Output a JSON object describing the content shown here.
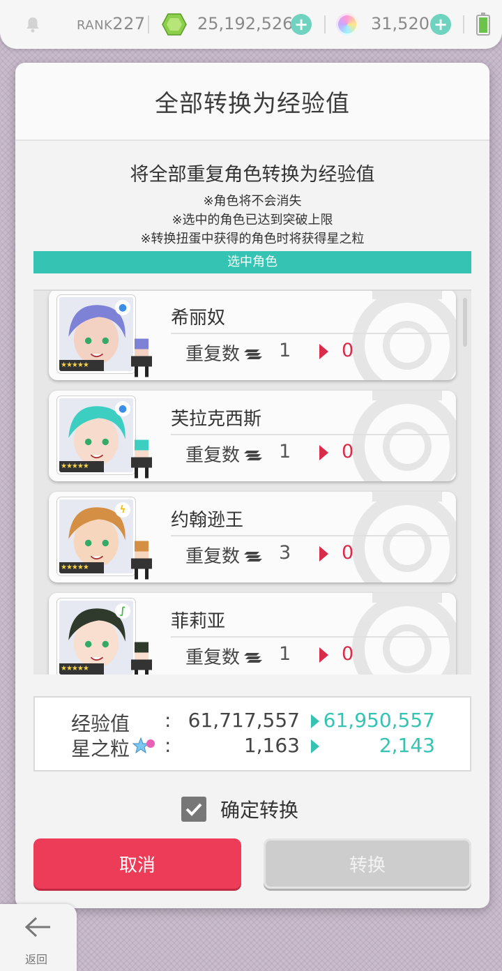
{
  "topbar": {
    "rank_prefix": "RANK",
    "rank_value": "227",
    "gems": "25,192,526",
    "orbs": "31,520",
    "icons": [
      "bell-icon",
      "gem-icon",
      "plus-icon",
      "orb-icon",
      "battery-icon"
    ]
  },
  "modal": {
    "title": "全部转换为经验值",
    "subtitle": "将全部重复角色转换为经验值",
    "notes": [
      "※角色将不会消失",
      "※选中的角色已达到突破上限",
      "※转换扭蛋中获得的角色时将获得星之粒"
    ],
    "selected_bar": "选中角色"
  },
  "characters": [
    {
      "name": "希丽奴",
      "dup_label": "重复数",
      "from": "1",
      "to": "0",
      "attribute": "water",
      "attr_color": "#3b8ee8",
      "rarity": "★★★★★",
      "hair": "#7d82d6",
      "skin": "#f3d2c4"
    },
    {
      "name": "芙拉克西斯",
      "dup_label": "重复数",
      "from": "1",
      "to": "0",
      "attribute": "water",
      "attr_color": "#3b8ee8",
      "rarity": "★★★★★",
      "hair": "#3ccfc1",
      "skin": "#f7dccd"
    },
    {
      "name": "约翰逊王",
      "dup_label": "重复数",
      "from": "3",
      "to": "0",
      "attribute": "thunder",
      "attr_color": "#f2c21b",
      "rarity": "★★★★★",
      "hair": "#d58f45",
      "skin": "#f6d6bd"
    },
    {
      "name": "菲莉亚",
      "dup_label": "重复数",
      "from": "1",
      "to": "0",
      "attribute": "wind",
      "attr_color": "#41b84a",
      "rarity": "★★★★★",
      "hair": "#2f3a2c",
      "skin": "#f8dfcf"
    }
  ],
  "summary": {
    "exp_label": "经验值",
    "exp_from": "61,717,557",
    "exp_to": "61,950,557",
    "stardust_label": "星之粒",
    "stardust_from": "1,163",
    "stardust_to": "2,143",
    "colon": ":"
  },
  "confirm": {
    "label": "确定转换",
    "checked": true
  },
  "buttons": {
    "cancel": "取消",
    "convert": "转换"
  },
  "back": {
    "label": "返回"
  },
  "colors": {
    "accent": "#35c4b3",
    "cancel": "#ec3c58",
    "arrow_red": "#d92c4a",
    "disabled": "#cdcdcd"
  }
}
